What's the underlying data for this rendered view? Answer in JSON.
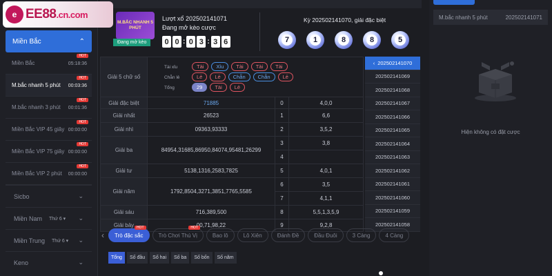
{
  "logo": {
    "brand": "EE88",
    "domain": ".cn.com"
  },
  "sidebar": {
    "region_active": "Miền Bắc",
    "subs": [
      {
        "name": "Miền Bắc",
        "time": "05:18:36",
        "hot": "HOT"
      },
      {
        "name": "M.bắc nhanh 5 phút",
        "time": "00:03:36",
        "hot": "HOT"
      },
      {
        "name": "M.bắc nhanh 3 phút",
        "time": "00:01:36",
        "hot": "HOT"
      },
      {
        "name": "Miền Bắc VIP 45 giây",
        "time": "00:00:00",
        "hot": "HOT"
      },
      {
        "name": "Miền Bắc VIP 75 giây",
        "time": "00:00:00",
        "hot": "HOT"
      },
      {
        "name": "Miền Bắc VIP 2 phút",
        "time": "00:00:00",
        "hot": "HOT"
      }
    ],
    "groups": [
      {
        "name": "Sicbo",
        "select": ""
      },
      {
        "name": "Miền Nam",
        "select": "Thứ 6 ▾"
      },
      {
        "name": "Miền Trung",
        "select": "Thứ 6 ▾"
      },
      {
        "name": "Keno",
        "select": ""
      }
    ]
  },
  "game": {
    "badge": "M.BẮC NHANH 5 PHÚT",
    "status": "Đang mở kèo",
    "draw_label": "Lượt xổ 202502141071",
    "open_label": "Đang mở kèo cược",
    "countdown": [
      "0",
      "0",
      "0",
      "3",
      "3",
      "6"
    ]
  },
  "result": {
    "title": "Kỳ 202502141070, giải đặc biệt",
    "balls": [
      "7",
      "1",
      "8",
      "8",
      "5"
    ]
  },
  "table": {
    "g5": "Giải 5 chữ số",
    "tx_label": "Tài xỉu",
    "tx": [
      "Tài",
      "Xỉu",
      "Tài",
      "Tài",
      "Tài"
    ],
    "cl_label": "Chẵn lẻ",
    "cl": [
      "Lẻ",
      "Lẻ",
      "Chẵn",
      "Chẵn",
      "Lẻ"
    ],
    "tong_label": "Tổng",
    "tong": [
      "29",
      "Tài",
      "Lẻ"
    ],
    "rows": [
      {
        "label": "Giải đặc biệt",
        "value": "71885"
      },
      {
        "label": "Giải nhất",
        "value": "26523"
      },
      {
        "label": "Giải nhì",
        "value": "09363,93333"
      },
      {
        "label": "Giải ba",
        "value": "84954,31685,86950,84074,95481,26299"
      },
      {
        "label": "Giải tư",
        "value": "5138,1316,2583,7825"
      },
      {
        "label": "Giải năm",
        "value": "1792,8504,3271,3851,7765,5585"
      },
      {
        "label": "Giải sáu",
        "value": "716,389,500"
      },
      {
        "label": "Giải bảy",
        "value": "00,71,98,22"
      }
    ],
    "heads": [
      "0",
      "1",
      "2",
      "3",
      "4",
      "5",
      "6",
      "7",
      "8",
      "9"
    ],
    "tails": [
      "4,0,0",
      "6,6",
      "3,5,2",
      "3,8",
      "",
      "4,0,1",
      "3,5",
      "4,1,1",
      "5,5,1,3,5,9",
      "9,2,8"
    ]
  },
  "periods": [
    "202502141070",
    "202502141069",
    "202502141068",
    "202502141067",
    "202502141066",
    "202502141065",
    "202502141064",
    "202502141063",
    "202502141062",
    "202502141061",
    "202502141060",
    "202502141059",
    "202502141058"
  ],
  "tabs": [
    {
      "label": "Trò đặc sắc",
      "hot": "HOT"
    },
    {
      "label": "Trò Chơi Thú Vị",
      "hot": "HOT"
    },
    {
      "label": "Bao lô",
      "hot": ""
    },
    {
      "label": "Lô Xiên",
      "hot": ""
    },
    {
      "label": "Đánh Đề",
      "hot": ""
    },
    {
      "label": "Đầu Đuôi",
      "hot": ""
    },
    {
      "label": "3 Càng",
      "hot": ""
    },
    {
      "label": "4 Càng",
      "hot": ""
    }
  ],
  "subtabs": [
    "Tổng",
    "Số đầu",
    "Số hai",
    "Số ba",
    "Số bốn",
    "Số năm"
  ],
  "right": {
    "game": "M.bắc nhanh 5 phút",
    "period": "202502141071",
    "empty": "Hiện không có đặt cược"
  },
  "colors": {
    "accent": "#2f6ed9",
    "hot": "#e53935",
    "teal": "#1d9e7d"
  }
}
